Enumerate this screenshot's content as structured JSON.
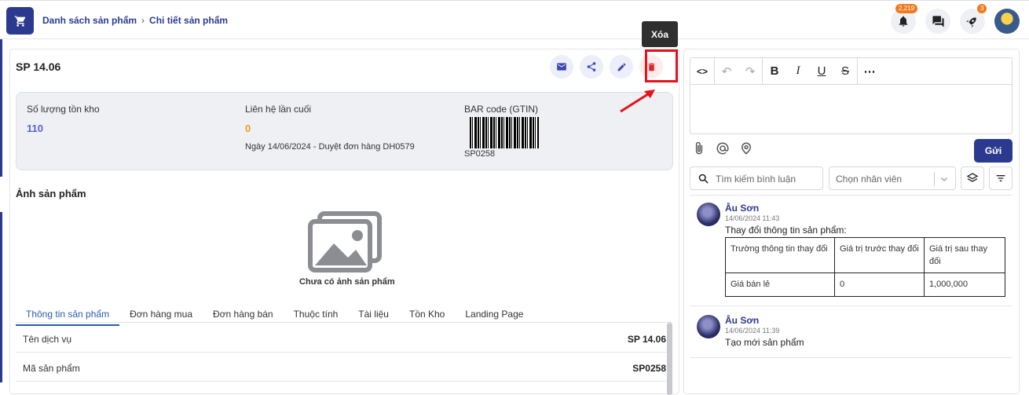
{
  "breadcrumb": {
    "item1": "Danh sách sản phẩm",
    "item2": "Chi tiết sản phẩm"
  },
  "notifications": {
    "badge": "2,219",
    "rocket_badge": "3"
  },
  "product": {
    "title": "SP 14.06",
    "tooltip": "Xóa",
    "stock_label": "Số lượng tồn kho",
    "stock_value": "110",
    "last_contact_label": "Liên hệ lần cuối",
    "last_contact_value": "0",
    "last_contact_note": "Ngày 14/06/2024 - Duyệt đơn hàng DH0579",
    "barcode_label": "BAR code (GTIN)",
    "barcode_value": "SP0258",
    "image_title": "Ảnh sản phẩm",
    "no_image": "Chưa có ảnh sản phẩm"
  },
  "tabs": [
    "Thông tin sản phẩm",
    "Đơn hàng mua",
    "Đơn hàng bán",
    "Thuộc tính",
    "Tài liệu",
    "Tồn Kho",
    "Landing Page"
  ],
  "details": [
    {
      "k": "Tên dịch vụ",
      "v": "SP 14.06"
    },
    {
      "k": "Mã sản phẩm",
      "v": "SP0258"
    }
  ],
  "comments_panel": {
    "send_label": "Gửi",
    "search_placeholder": "Tìm kiếm bình luận",
    "select_placeholder": "Chọn nhân viên"
  },
  "comments": [
    {
      "name": "Âu Sơn",
      "time": "14/06/2024 11:43",
      "text": "Thay đổi thông tin sản phẩm:",
      "table": {
        "h1": "Trường thông tin thay đổi",
        "h2": "Giá trị trước thay đổi",
        "h3": "Giá trị sau thay đổi",
        "r1": "Giá bán lẻ",
        "r2": "0",
        "r3": "1,000,000"
      }
    },
    {
      "name": "Âu Sơn",
      "time": "14/06/2024 11:39",
      "text": "Tạo mới sản phẩm"
    }
  ]
}
